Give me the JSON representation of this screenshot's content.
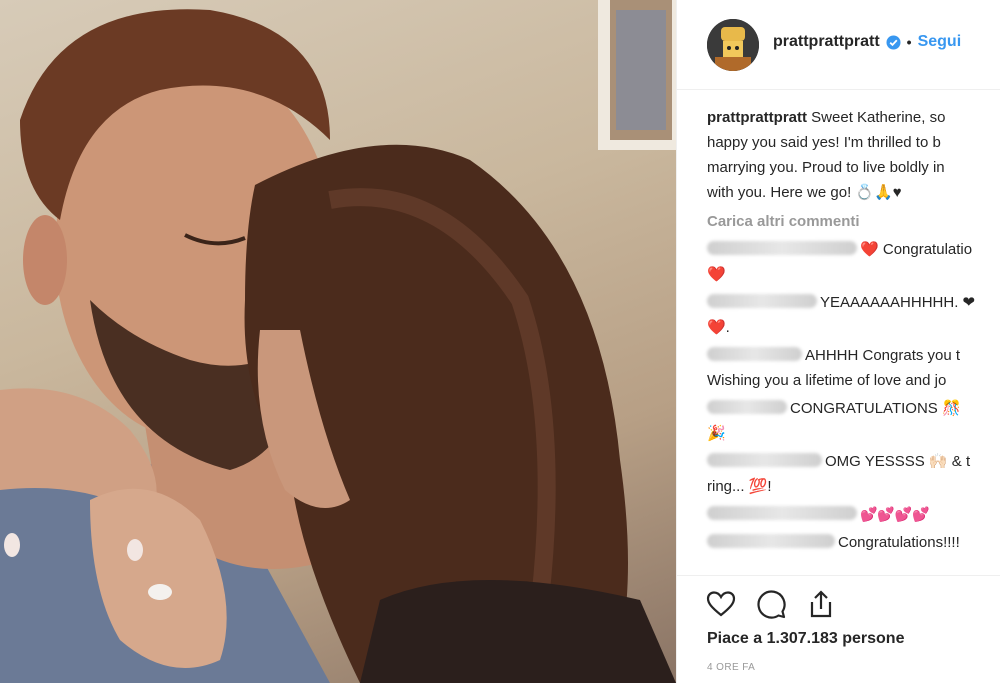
{
  "post": {
    "image_alt": "",
    "username": "prattprattpratt",
    "separator": "•",
    "follow_label": "Segui"
  },
  "caption": {
    "username": "prattprattpratt",
    "lines": [
      " Sweet Katherine, so",
      "happy you said yes! I'm thrilled to b",
      "marrying you. Proud to live boldly in",
      "with you. Here we go! 💍🙏♥"
    ]
  },
  "load_more_label": "Carica altri commenti",
  "comments": [
    {
      "lines": [
        "Congratulatio",
        "❤️"
      ]
    },
    {
      "lines": [
        "YEAAAAAAHHHHH. ❤",
        "❤️."
      ]
    },
    {
      "lines": [
        "AHHHH Congrats you t",
        "Wishing you a lifetime of love and jo"
      ]
    },
    {
      "lines": [
        "CONGRATULATIONS 🎊 ",
        "🎉"
      ]
    },
    {
      "lines": [
        "OMG YESSSS 🙌🏻 & t",
        "ring... 💯!"
      ]
    },
    {
      "lines": [
        "💕💕💕💕"
      ]
    },
    {
      "lines": [
        "Congratulations!!!!"
      ]
    }
  ],
  "actions": {
    "likes_text": "Piace a 1.307.183 persone",
    "time_text": "4 ORE FA",
    "like_icon": "heart-icon",
    "comment_icon": "comment-bubble-icon",
    "share_icon": "share-icon"
  },
  "colors": {
    "follow": "#3897f0",
    "muted": "#999999",
    "text": "#262626",
    "heart": "#e0263a"
  }
}
